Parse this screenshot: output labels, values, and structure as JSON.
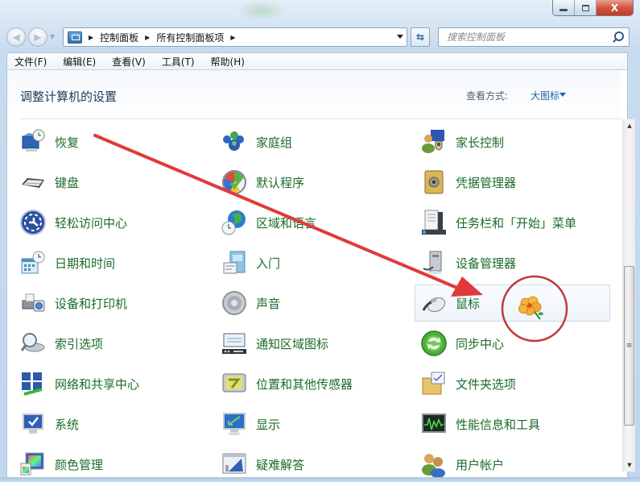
{
  "window": {
    "controls": {
      "minimize": "minimize",
      "maximize": "maximize",
      "close": "X"
    }
  },
  "navigation": {
    "back_icon": "back-arrow-icon",
    "forward_icon": "forward-arrow-icon",
    "breadcrumb": [
      "控制面板",
      "所有控制面板项"
    ],
    "refresh_icon": "refresh-icon",
    "search_placeholder": "搜索控制面板"
  },
  "menu": {
    "items": [
      "文件(F)",
      "编辑(E)",
      "查看(V)",
      "工具(T)",
      "帮助(H)"
    ]
  },
  "content": {
    "title": "调整计算机的设置",
    "view_by_label": "查看方式:",
    "view_mode": "大图标"
  },
  "columns": [
    {
      "items": [
        {
          "label": "恢复",
          "icon": "recovery-icon"
        },
        {
          "label": "键盘",
          "icon": "keyboard-icon"
        },
        {
          "label": "轻松访问中心",
          "icon": "ease-of-access-icon"
        },
        {
          "label": "日期和时间",
          "icon": "date-time-icon"
        },
        {
          "label": "设备和打印机",
          "icon": "devices-printers-icon"
        },
        {
          "label": "索引选项",
          "icon": "indexing-options-icon"
        },
        {
          "label": "网络和共享中心",
          "icon": "network-sharing-icon"
        },
        {
          "label": "系统",
          "icon": "system-icon"
        },
        {
          "label": "颜色管理",
          "icon": "color-management-icon"
        }
      ]
    },
    {
      "items": [
        {
          "label": "家庭组",
          "icon": "homegroup-icon"
        },
        {
          "label": "默认程序",
          "icon": "default-programs-icon"
        },
        {
          "label": "区域和语言",
          "icon": "region-language-icon"
        },
        {
          "label": "入门",
          "icon": "getting-started-icon"
        },
        {
          "label": "声音",
          "icon": "sound-icon"
        },
        {
          "label": "通知区域图标",
          "icon": "notification-area-icon"
        },
        {
          "label": "位置和其他传感器",
          "icon": "location-sensors-icon"
        },
        {
          "label": "显示",
          "icon": "display-icon"
        },
        {
          "label": "疑难解答",
          "icon": "troubleshooting-icon"
        }
      ]
    },
    {
      "items": [
        {
          "label": "家长控制",
          "icon": "parental-controls-icon"
        },
        {
          "label": "凭据管理器",
          "icon": "credential-manager-icon"
        },
        {
          "label": "任务栏和「开始」菜单",
          "icon": "taskbar-start-menu-icon"
        },
        {
          "label": "设备管理器",
          "icon": "device-manager-icon"
        },
        {
          "label": "鼠标",
          "icon": "mouse-icon",
          "highlighted": true
        },
        {
          "label": "同步中心",
          "icon": "sync-center-icon"
        },
        {
          "label": "文件夹选项",
          "icon": "folder-options-icon"
        },
        {
          "label": "性能信息和工具",
          "icon": "performance-icon"
        },
        {
          "label": "用户帐户",
          "icon": "user-accounts-icon"
        }
      ]
    }
  ],
  "annotation": {
    "arrow_color": "#e23a3a",
    "circle_color": "#c0393b",
    "cursor_icon": "flower-cursor-icon"
  },
  "colors": {
    "item_text": "#1b6b2b",
    "title_text": "#1e3b5b",
    "link_blue": "#1e5fa8"
  }
}
